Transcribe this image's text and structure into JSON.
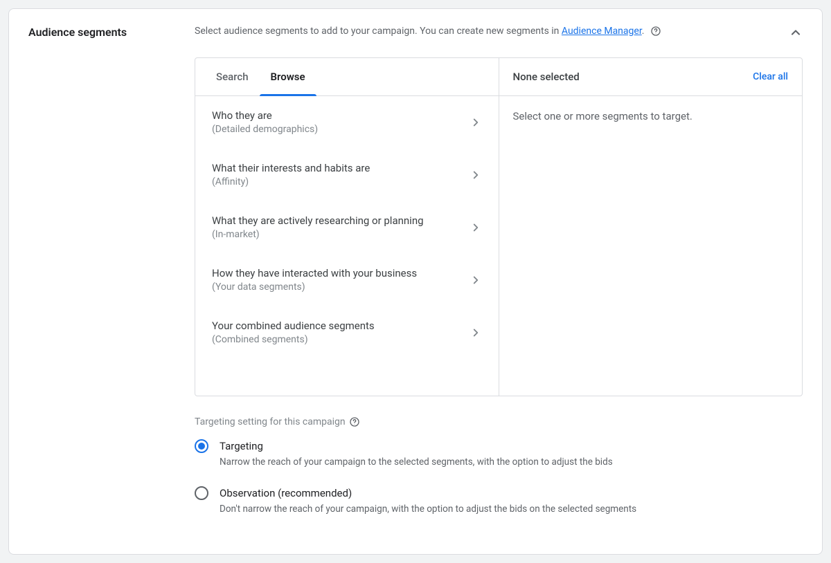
{
  "header": {
    "title": "Audience segments",
    "description_prefix": "Select audience segments to add to your campaign. You can create new segments in ",
    "link_text": "Audience Manager",
    "description_suffix": "."
  },
  "tabs": {
    "search": "Search",
    "browse": "Browse",
    "active": "browse"
  },
  "browse_items": [
    {
      "title": "Who they are",
      "subtitle": "(Detailed demographics)"
    },
    {
      "title": "What their interests and habits are",
      "subtitle": "(Affinity)"
    },
    {
      "title": "What they are actively researching or planning",
      "subtitle": "(In-market)"
    },
    {
      "title": "How they have interacted with your business",
      "subtitle": "(Your data segments)"
    },
    {
      "title": "Your combined audience segments",
      "subtitle": "(Combined segments)"
    }
  ],
  "right_panel": {
    "title": "None selected",
    "clear_all": "Clear all",
    "empty_text": "Select one or more segments to target."
  },
  "targeting": {
    "heading": "Targeting setting for this campaign",
    "options": [
      {
        "id": "targeting",
        "label": "Targeting",
        "desc": "Narrow the reach of your campaign to the selected segments, with the option to adjust the bids",
        "selected": true
      },
      {
        "id": "observation",
        "label": "Observation (recommended)",
        "desc": "Don't narrow the reach of your campaign, with the option to adjust the bids on the selected segments",
        "selected": false
      }
    ]
  }
}
